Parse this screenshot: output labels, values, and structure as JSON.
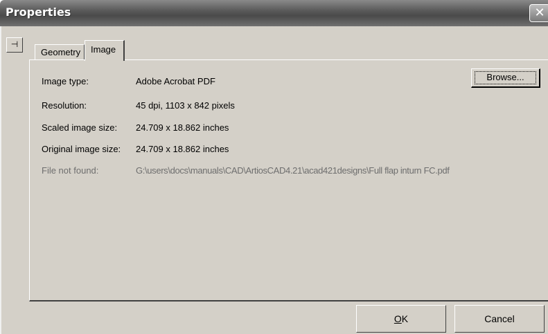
{
  "window": {
    "title": "Properties",
    "close_glyph": "✕"
  },
  "pin": {
    "icon": "pin-icon",
    "glyph": "⊣"
  },
  "tabs": [
    {
      "label": "Geometry",
      "active": false
    },
    {
      "label": "Image",
      "active": true
    }
  ],
  "image_tab": {
    "browse_label": "Browse...",
    "rows": [
      {
        "label": "Image type:",
        "value": "Adobe Acrobat PDF"
      },
      {
        "label": "Resolution:",
        "value": "45 dpi, 1103 x 842 pixels"
      },
      {
        "label": "Scaled image size:",
        "value": "24.709 x 18.862 inches"
      },
      {
        "label": "Original image size:",
        "value": "24.709 x 18.862 inches"
      },
      {
        "label": "File not found:",
        "value": "G:\\users\\docs\\manuals\\CAD\\ArtiosCAD4.21\\acad421designs\\Full flap inturn FC.pdf"
      }
    ]
  },
  "buttons": {
    "ok_letter": "O",
    "ok_rest": "K",
    "cancel": "Cancel"
  },
  "colors": {
    "dialog_bg": "#d4d0c8",
    "disabled_text": "#6e6e6e"
  }
}
